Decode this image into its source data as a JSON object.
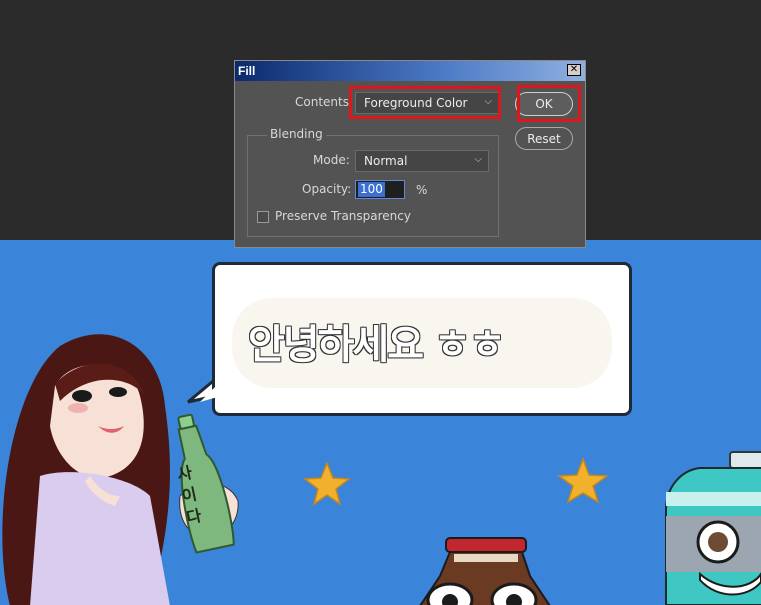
{
  "dialog": {
    "title": "Fill",
    "close_icon": "close-icon",
    "contents_label": "Contents:",
    "contents_value": "Foreground Color",
    "ok_label": "OK",
    "reset_label": "Reset",
    "blending_label": "Blending",
    "mode_label": "Mode:",
    "mode_value": "Normal",
    "opacity_label": "Opacity:",
    "opacity_value": "100",
    "opacity_unit": "%",
    "preserve_label": "Preserve Transparency",
    "preserve_checked": false
  },
  "canvas": {
    "bubble_text": "안녕하세요 ㅎㅎ",
    "bottle_label": "사이다",
    "background_color": "#3a84d9"
  },
  "colors": {
    "highlight": "#e0141b",
    "dialog_bg": "#535353",
    "workspace_bg": "#2b2b2b"
  }
}
